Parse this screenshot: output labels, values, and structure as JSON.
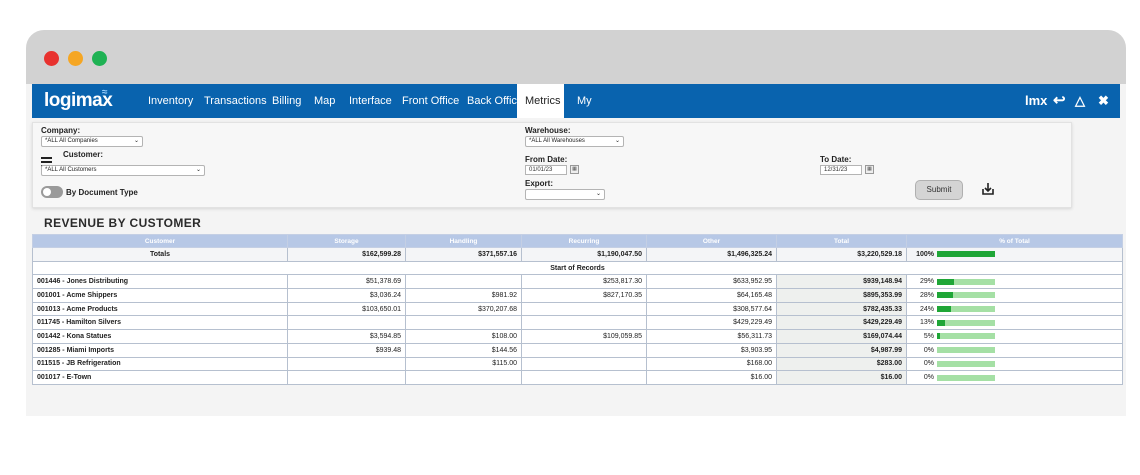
{
  "nav": {
    "logo": "logimax",
    "items": [
      "Inventory",
      "Transactions",
      "Billing",
      "Map",
      "Interface",
      "Front Office",
      "Back Office",
      "Metrics",
      "My"
    ],
    "active": "Metrics",
    "user_label": "lmx"
  },
  "filters": {
    "company_label": "Company:",
    "company_value": "*ALL All Companies",
    "customer_label": "Customer:",
    "customer_value": "*ALL All Customers",
    "doc_type_label": "By Document Type",
    "warehouse_label": "Warehouse:",
    "warehouse_value": "*ALL All Warehouses",
    "from_date_label": "From Date:",
    "from_date_value": "01/01/23",
    "to_date_label": "To Date:",
    "to_date_value": "12/31/23",
    "export_label": "Export:",
    "export_value": "",
    "submit_label": "Submit"
  },
  "report": {
    "title": "REVENUE BY CUSTOMER",
    "columns": [
      "Customer",
      "Storage",
      "Handling",
      "Recurring",
      "Other",
      "Total",
      "% of Total"
    ],
    "totals": {
      "label": "Totals",
      "storage": "$162,599.28",
      "handling": "$371,557.16",
      "recurring": "$1,190,047.50",
      "other": "$1,496,325.24",
      "total": "$3,220,529.18",
      "pct": "100%",
      "pct_value": 100
    },
    "start_label": "Start of Records",
    "rows": [
      {
        "customer": "001446 - Jones Distributing",
        "storage": "$51,378.69",
        "handling": "",
        "recurring": "$253,817.30",
        "other": "$633,952.95",
        "total": "$939,148.94",
        "pct": "29%",
        "pct_value": 29
      },
      {
        "customer": "001001 - Acme Shippers",
        "storage": "$3,036.24",
        "handling": "$981.92",
        "recurring": "$827,170.35",
        "other": "$64,165.48",
        "total": "$895,353.99",
        "pct": "28%",
        "pct_value": 28
      },
      {
        "customer": "001013 - Acme Products",
        "storage": "$103,650.01",
        "handling": "$370,207.68",
        "recurring": "",
        "other": "$308,577.64",
        "total": "$782,435.33",
        "pct": "24%",
        "pct_value": 24
      },
      {
        "customer": "011745 - Hamilton Silvers",
        "storage": "",
        "handling": "",
        "recurring": "",
        "other": "$429,229.49",
        "total": "$429,229.49",
        "pct": "13%",
        "pct_value": 13
      },
      {
        "customer": "001442 - Kona Statues",
        "storage": "$3,594.85",
        "handling": "$108.00",
        "recurring": "$109,059.85",
        "other": "$56,311.73",
        "total": "$169,074.44",
        "pct": "5%",
        "pct_value": 5
      },
      {
        "customer": "001285 - Miami Imports",
        "storage": "$939.48",
        "handling": "$144.56",
        "recurring": "",
        "other": "$3,903.95",
        "total": "$4,987.99",
        "pct": "0%",
        "pct_value": 0
      },
      {
        "customer": "011515 - JB Refrigeration",
        "storage": "",
        "handling": "$115.00",
        "recurring": "",
        "other": "$168.00",
        "total": "$283.00",
        "pct": "0%",
        "pct_value": 0
      },
      {
        "customer": "001017 - E-Town",
        "storage": "",
        "handling": "",
        "recurring": "",
        "other": "$16.00",
        "total": "$16.00",
        "pct": "0%",
        "pct_value": 0
      }
    ]
  }
}
